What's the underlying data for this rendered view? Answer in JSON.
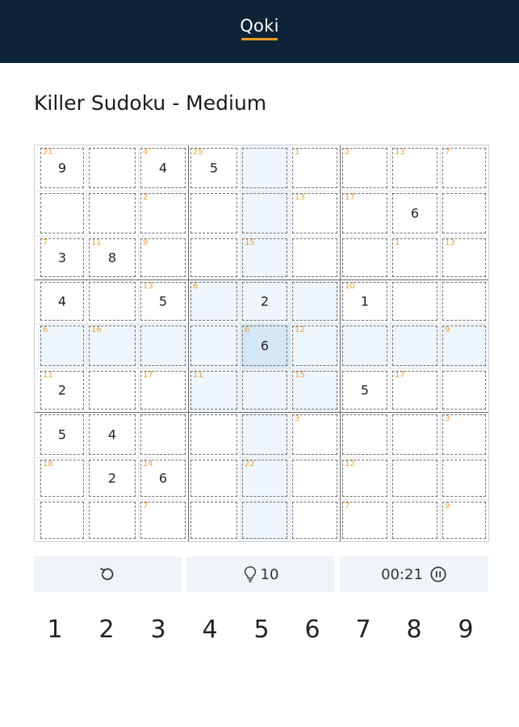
{
  "header": {
    "brand": "Qoki"
  },
  "page": {
    "title": "Killer Sudoku - Medium"
  },
  "board": {
    "rows": 9,
    "cols": 9,
    "selected": [
      4,
      4
    ],
    "cells": [
      [
        {
          "v": "9",
          "s": "21"
        },
        {
          "v": "",
          "s": ""
        },
        {
          "v": "4",
          "s": "4"
        },
        {
          "v": "5",
          "s": "25"
        },
        {
          "v": "",
          "s": ""
        },
        {
          "v": "",
          "s": "1"
        },
        {
          "v": "",
          "s": "2"
        },
        {
          "v": "",
          "s": "13"
        },
        {
          "v": "",
          "s": "7"
        }
      ],
      [
        {
          "v": "",
          "s": ""
        },
        {
          "v": "",
          "s": ""
        },
        {
          "v": "",
          "s": "2"
        },
        {
          "v": "",
          "s": ""
        },
        {
          "v": "",
          "s": ""
        },
        {
          "v": "",
          "s": "13"
        },
        {
          "v": "",
          "s": "17"
        },
        {
          "v": "6",
          "s": ""
        },
        {
          "v": "",
          "s": ""
        }
      ],
      [
        {
          "v": "3",
          "s": "7"
        },
        {
          "v": "8",
          "s": "11"
        },
        {
          "v": "",
          "s": "9"
        },
        {
          "v": "",
          "s": ""
        },
        {
          "v": "",
          "s": "15"
        },
        {
          "v": "",
          "s": ""
        },
        {
          "v": "",
          "s": ""
        },
        {
          "v": "",
          "s": "1"
        },
        {
          "v": "",
          "s": "13"
        }
      ],
      [
        {
          "v": "4",
          "s": ""
        },
        {
          "v": "",
          "s": ""
        },
        {
          "v": "5",
          "s": "13"
        },
        {
          "v": "",
          "s": "6"
        },
        {
          "v": "2",
          "s": ""
        },
        {
          "v": "",
          "s": ""
        },
        {
          "v": "1",
          "s": "10"
        },
        {
          "v": "",
          "s": ""
        },
        {
          "v": "",
          "s": ""
        }
      ],
      [
        {
          "v": "",
          "s": "6"
        },
        {
          "v": "",
          "s": "16"
        },
        {
          "v": "",
          "s": ""
        },
        {
          "v": "",
          "s": ""
        },
        {
          "v": "6",
          "s": "6"
        },
        {
          "v": "",
          "s": "12"
        },
        {
          "v": "",
          "s": ""
        },
        {
          "v": "",
          "s": ""
        },
        {
          "v": "",
          "s": "9"
        }
      ],
      [
        {
          "v": "2",
          "s": "11"
        },
        {
          "v": "",
          "s": ""
        },
        {
          "v": "",
          "s": "17"
        },
        {
          "v": "",
          "s": "11"
        },
        {
          "v": "",
          "s": ""
        },
        {
          "v": "",
          "s": "15"
        },
        {
          "v": "5",
          "s": ""
        },
        {
          "v": "",
          "s": "17"
        },
        {
          "v": "",
          "s": ""
        }
      ],
      [
        {
          "v": "5",
          "s": ""
        },
        {
          "v": "4",
          "s": ""
        },
        {
          "v": "",
          "s": ""
        },
        {
          "v": "",
          "s": ""
        },
        {
          "v": "",
          "s": ""
        },
        {
          "v": "",
          "s": "3"
        },
        {
          "v": "",
          "s": ""
        },
        {
          "v": "",
          "s": ""
        },
        {
          "v": "",
          "s": "3"
        }
      ],
      [
        {
          "v": "",
          "s": "18"
        },
        {
          "v": "2",
          "s": ""
        },
        {
          "v": "6",
          "s": "14"
        },
        {
          "v": "",
          "s": ""
        },
        {
          "v": "",
          "s": "22"
        },
        {
          "v": "",
          "s": ""
        },
        {
          "v": "",
          "s": "12"
        },
        {
          "v": "",
          "s": ""
        },
        {
          "v": "",
          "s": ""
        }
      ],
      [
        {
          "v": "",
          "s": ""
        },
        {
          "v": "",
          "s": ""
        },
        {
          "v": "",
          "s": "7"
        },
        {
          "v": "",
          "s": ""
        },
        {
          "v": "",
          "s": ""
        },
        {
          "v": "",
          "s": ""
        },
        {
          "v": "",
          "s": "7"
        },
        {
          "v": "",
          "s": ""
        },
        {
          "v": "",
          "s": "9"
        }
      ]
    ]
  },
  "controls": {
    "undo_icon": "undo-icon",
    "hint_icon": "lightbulb-icon",
    "hints_left": "10",
    "timer": "00:21",
    "pause_icon": "pause-icon"
  },
  "numpad": [
    "1",
    "2",
    "3",
    "4",
    "5",
    "6",
    "7",
    "8",
    "9"
  ],
  "colors": {
    "header_bg": "#0d2338",
    "accent": "#f29a1f",
    "cage_sum": "#f0a233",
    "highlight": "#eef5fb",
    "selected": "#d4e7f7"
  }
}
